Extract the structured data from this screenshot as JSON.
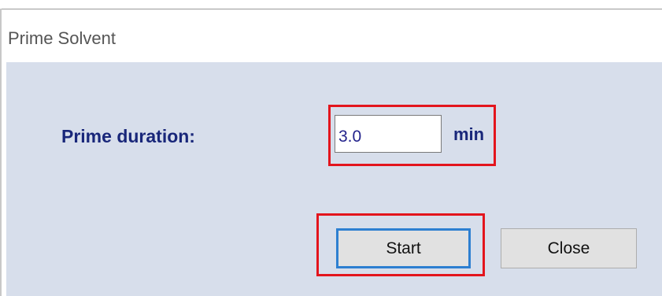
{
  "window": {
    "title": "Prime Solvent"
  },
  "form": {
    "duration_label": "Prime duration:",
    "duration_value": "3.0",
    "duration_unit": "min"
  },
  "buttons": {
    "start_label": "Start",
    "close_label": "Close"
  },
  "colors": {
    "client_background": "#d7deeb",
    "label_text": "#19277a",
    "highlight_outline": "#e3151d",
    "focused_button_border": "#2d7fd1"
  }
}
